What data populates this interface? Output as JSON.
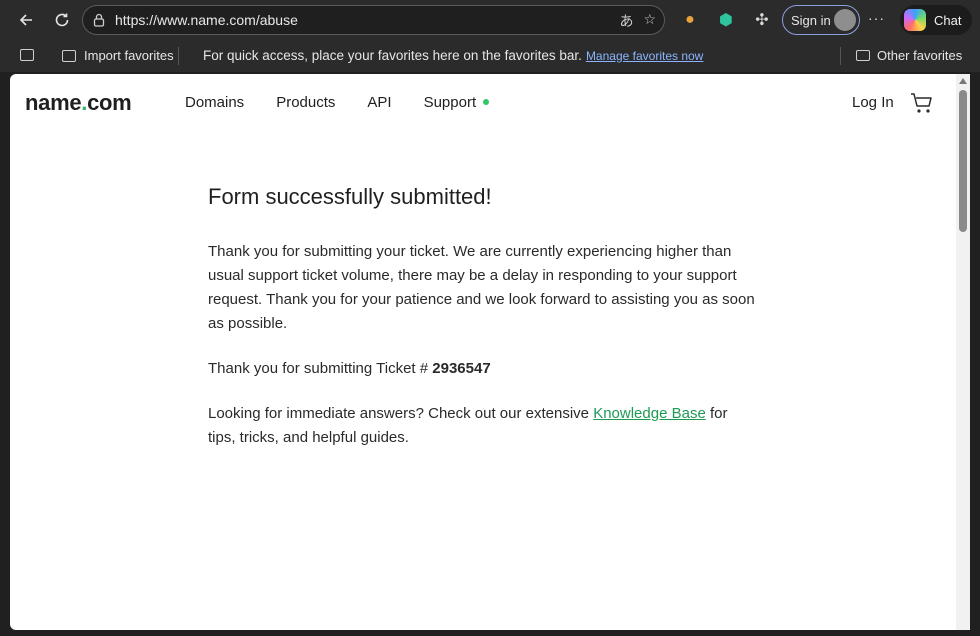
{
  "browser": {
    "url": "https://www.name.com/abuse",
    "signin_label": "Sign in",
    "chat_label": "Chat",
    "favorites": {
      "import_label": "Import favorites",
      "prompt_text": "For quick access, place your favorites here on the favorites bar.",
      "manage_link": "Manage favorites now",
      "other_label": "Other favorites"
    }
  },
  "site": {
    "logo_part1": "name",
    "logo_dot": ".",
    "logo_part2": "com",
    "nav": {
      "domains": "Domains",
      "products": "Products",
      "api": "API",
      "support": "Support"
    },
    "login_label": "Log In"
  },
  "content": {
    "title": "Form successfully submitted!",
    "para1": "Thank you for submitting your ticket. We are currently experiencing higher than usual support ticket volume, there may be a delay in responding to your support request. Thank you for your patience and we look forward to assisting you as soon as possible.",
    "ticket_prefix": "Thank you for submitting Ticket #",
    "ticket_number": "2936547",
    "kb_prefix": "Looking for immediate answers? Check out our extensive",
    "kb_link": "Knowledge Base",
    "kb_suffix": "for tips, tricks, and helpful guides."
  },
  "colors": {
    "accent_green": "#34b566",
    "link_green": "#1f9a55"
  }
}
